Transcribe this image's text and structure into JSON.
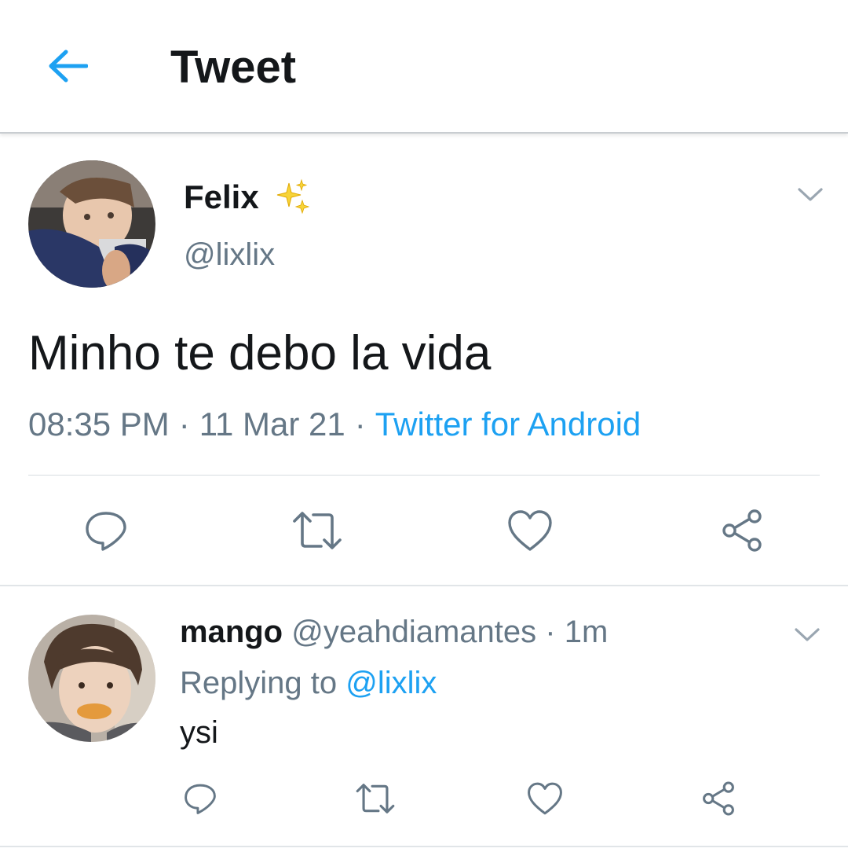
{
  "header": {
    "title": "Tweet",
    "back_icon": "arrow-left-icon"
  },
  "colors": {
    "accent": "#1da1f2",
    "text_primary": "#14171a",
    "text_secondary": "#657786",
    "icon_gray": "#657786"
  },
  "tweet": {
    "display_name": "Felix",
    "name_emoji": "sparkles-icon",
    "handle": "@lixlix",
    "text": "Minho te debo la vida",
    "time": "08:35 PM",
    "date": "11 Mar 21",
    "separator": "·",
    "source": "Twitter for Android",
    "actions": [
      "reply-icon",
      "retweet-icon",
      "like-icon",
      "share-icon"
    ]
  },
  "reply": {
    "display_name": "mango",
    "handle": "@yeahdiamantes",
    "separator": "·",
    "time_ago": "1m",
    "replying_prefix": "Replying to",
    "replying_to": "@lixlix",
    "text": "ysi",
    "actions": [
      "reply-icon",
      "retweet-icon",
      "like-icon",
      "share-icon"
    ]
  }
}
